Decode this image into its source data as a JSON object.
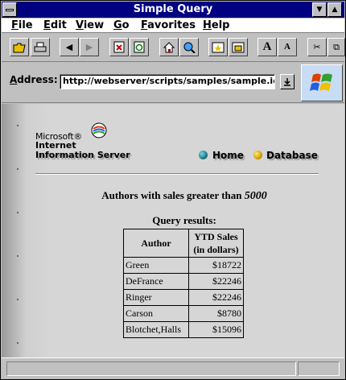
{
  "window": {
    "title": "Simple Query"
  },
  "menu": [
    {
      "first": "F",
      "rest": "ile"
    },
    {
      "first": "E",
      "rest": "dit"
    },
    {
      "first": "V",
      "rest": "iew"
    },
    {
      "first": "G",
      "rest": "o"
    },
    {
      "first": "F",
      "rest": "avorites"
    },
    {
      "first": "H",
      "rest": "elp"
    }
  ],
  "address": {
    "label_first": "A",
    "label_rest": "ddress:",
    "value": "http://webserver/scripts/samples/sample.idc?"
  },
  "logo": {
    "line1": "Microsoft®",
    "line2": "Internet",
    "line3": "Information Server"
  },
  "nav": {
    "home": "Home",
    "database": "Database"
  },
  "page": {
    "heading": "Authors with sales greater than",
    "threshold": "5000",
    "results_label": "Query results:"
  },
  "table": {
    "headers": [
      "Author",
      "YTD Sales",
      "(in dollars)"
    ],
    "rows": [
      {
        "author": "Green",
        "sales": "$18722"
      },
      {
        "author": "DeFrance",
        "sales": "$22246"
      },
      {
        "author": "Ringer",
        "sales": "$22246"
      },
      {
        "author": "Carson",
        "sales": "$8780"
      },
      {
        "author": "Blotchet,Halls",
        "sales": "$15096"
      }
    ]
  },
  "colors": {
    "titlebar": "#000080",
    "home_dot": "#1a7a8a",
    "database_dot": "#d4a000"
  }
}
